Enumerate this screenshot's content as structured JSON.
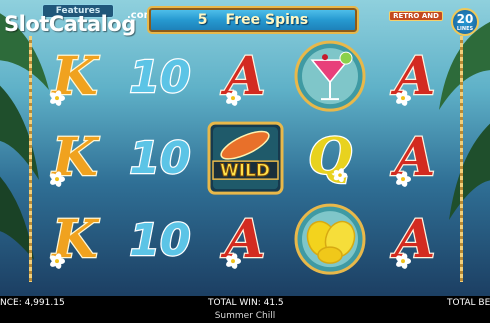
{
  "watermark": {
    "text": "SlotCatalog",
    "domain": ".com"
  },
  "header": {
    "features_label": "Features",
    "free_spins_count": "5",
    "free_spins_label": "Free Spins",
    "retro_label": "RETRO AND",
    "lines_count": "20",
    "lines_label": "LINES"
  },
  "symbols": {
    "K": "K",
    "ten": "10",
    "A": "A",
    "Q": "Q",
    "wild": "WILD"
  },
  "reels": [
    [
      "K",
      "ten",
      "A",
      "cocktail",
      "A"
    ],
    [
      "K",
      "ten",
      "wild",
      "Q",
      "A"
    ],
    [
      "K",
      "ten",
      "A",
      "lemon",
      "A"
    ]
  ],
  "footer": {
    "balance": "NCE: 4,991.15",
    "total_win": "TOTAL WIN: 41.5",
    "total_bet": "TOTAL BE",
    "game_name": "Summer Chill"
  },
  "colors": {
    "K": "#f0a21f",
    "ten": "#5cc4e6",
    "A": "#d32b20",
    "Q": "#e8d21f",
    "accent_gold": "#e8b84a"
  }
}
